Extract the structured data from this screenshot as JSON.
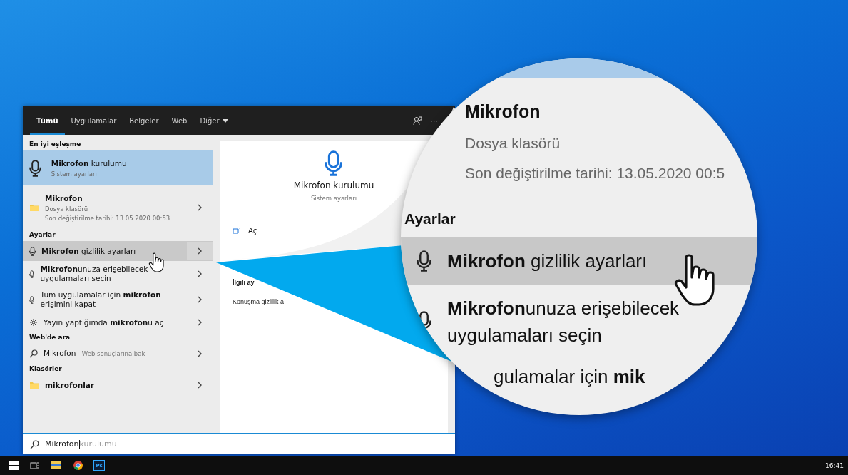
{
  "search_window": {
    "tabs": [
      {
        "label": "Tümü",
        "selected": true,
        "dropdown": false
      },
      {
        "label": "Uygulamalar",
        "selected": false,
        "dropdown": false
      },
      {
        "label": "Belgeler",
        "selected": false,
        "dropdown": false
      },
      {
        "label": "Web",
        "selected": false,
        "dropdown": false
      },
      {
        "label": "Diğer",
        "selected": false,
        "dropdown": true
      }
    ],
    "more_label": "···",
    "sections": [
      {
        "heading": "En iyi eşleşme",
        "items": [
          {
            "kind": "best",
            "title": "**Mikrofon** kurulumu",
            "subtitle": "Sistem ayarları",
            "selected": true,
            "hovered": false
          }
        ]
      },
      {
        "items": [
          {
            "kind": "file",
            "title": "Mikrofon",
            "subtitle": "Dosya klasörü",
            "detail": "Son değiştirilme tarihi: 13.05.2020 00:53",
            "selected": false,
            "hovered": false
          }
        ]
      },
      {
        "heading": "Ayarlar",
        "items": [
          {
            "kind": "setting",
            "title": "**Mikrofon** gizlilik ayarları",
            "selected": false,
            "hovered": true
          },
          {
            "kind": "setting",
            "title": "**Mikrofon**unuza erişebilecek uygulamaları seçin",
            "selected": false,
            "hovered": false
          },
          {
            "kind": "setting",
            "title": "Tüm uygulamalar için **mikrofon** erişimini kapat",
            "selected": false,
            "hovered": false
          },
          {
            "kind": "option",
            "title": "Yayın yaptığımda **mikrofon**u aç",
            "selected": false,
            "hovered": false
          }
        ]
      },
      {
        "heading": "Web'de ara",
        "items": [
          {
            "kind": "web",
            "title": "Mikrofon",
            "note": " - Web sonuçlarına bak",
            "selected": false,
            "hovered": false
          }
        ]
      },
      {
        "heading": "Klasörler",
        "items": [
          {
            "kind": "folder",
            "title": "mikrofonlar",
            "selected": false,
            "hovered": false
          }
        ]
      }
    ],
    "preview": {
      "title": "Mikrofon kurulumu",
      "subtitle": "Sistem ayarları",
      "action": "Aç",
      "related_heading": "İlgili ay",
      "related_link": "Konuşma gizlilik a"
    },
    "search": {
      "value": "Mikrofon",
      "suggestion": "kurulumu"
    }
  },
  "magnifier": {
    "rows": [
      {
        "kind": "title",
        "text": "Mikrofon"
      },
      {
        "kind": "meta",
        "text": "Dosya klasörü"
      },
      {
        "kind": "meta",
        "text": "Son değiştirilme tarihi: 13.05.2020 00:5"
      },
      {
        "kind": "heading",
        "text": "Ayarlar"
      },
      {
        "kind": "item",
        "text": "**Mikrofon** gizlilik ayarları",
        "hovered": true
      },
      {
        "kind": "item",
        "text": "**Mikrofon**unuza erişebilecek uygulamaları seçin",
        "hovered": false
      },
      {
        "kind": "cut",
        "text": "gulamalar için **mik**"
      }
    ]
  },
  "taskbar": {
    "apps": [
      {
        "kind": "start"
      },
      {
        "kind": "taskview"
      },
      {
        "kind": "explorer"
      },
      {
        "kind": "browser"
      },
      {
        "kind": "photoshop",
        "label": "Ps"
      }
    ],
    "clock": "16:41"
  }
}
